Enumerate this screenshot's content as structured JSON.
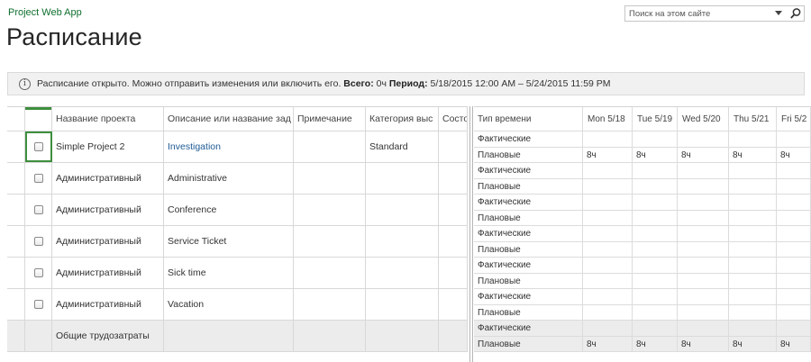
{
  "app": {
    "title": "Project Web App"
  },
  "page": {
    "title": "Расписание"
  },
  "search": {
    "placeholder": "Поиск на этом сайте"
  },
  "status": {
    "message": "Расписание открыто. Можно отправить изменения или включить его.",
    "total_label": "Всего:",
    "total_value": "0ч",
    "period_label": "Период:",
    "period_value": "5/18/2015 12:00 AM – 5/24/2015 11:59 PM"
  },
  "left_grid": {
    "headers": [
      "Название проекта",
      "Описание или название зад",
      "Примечание",
      "Категория выс",
      "Состо"
    ],
    "rows": [
      {
        "project": "Simple Project 2",
        "task": "Investigation",
        "note": "",
        "category": "Standard",
        "state": ""
      },
      {
        "project": "Административный",
        "task": "Administrative",
        "note": "",
        "category": "",
        "state": ""
      },
      {
        "project": "Административный",
        "task": "Conference",
        "note": "",
        "category": "",
        "state": ""
      },
      {
        "project": "Административный",
        "task": "Service Ticket",
        "note": "",
        "category": "",
        "state": ""
      },
      {
        "project": "Административный",
        "task": "Sick time",
        "note": "",
        "category": "",
        "state": ""
      },
      {
        "project": "Административный",
        "task": "Vacation",
        "note": "",
        "category": "",
        "state": ""
      }
    ],
    "total_label": "Общие трудозатраты"
  },
  "right_grid": {
    "header_type": "Тип времени",
    "days": [
      "Mon 5/18",
      "Tue 5/19",
      "Wed 5/20",
      "Thu 5/21",
      "Fri 5/2"
    ],
    "actual_label": "Фактические",
    "planned_label": "Плановые",
    "first_planned_values": [
      "8ч",
      "8ч",
      "8ч",
      "8ч",
      "8ч"
    ],
    "total_planned_values": [
      "8ч",
      "8ч",
      "8ч",
      "8ч",
      "8ч"
    ]
  }
}
